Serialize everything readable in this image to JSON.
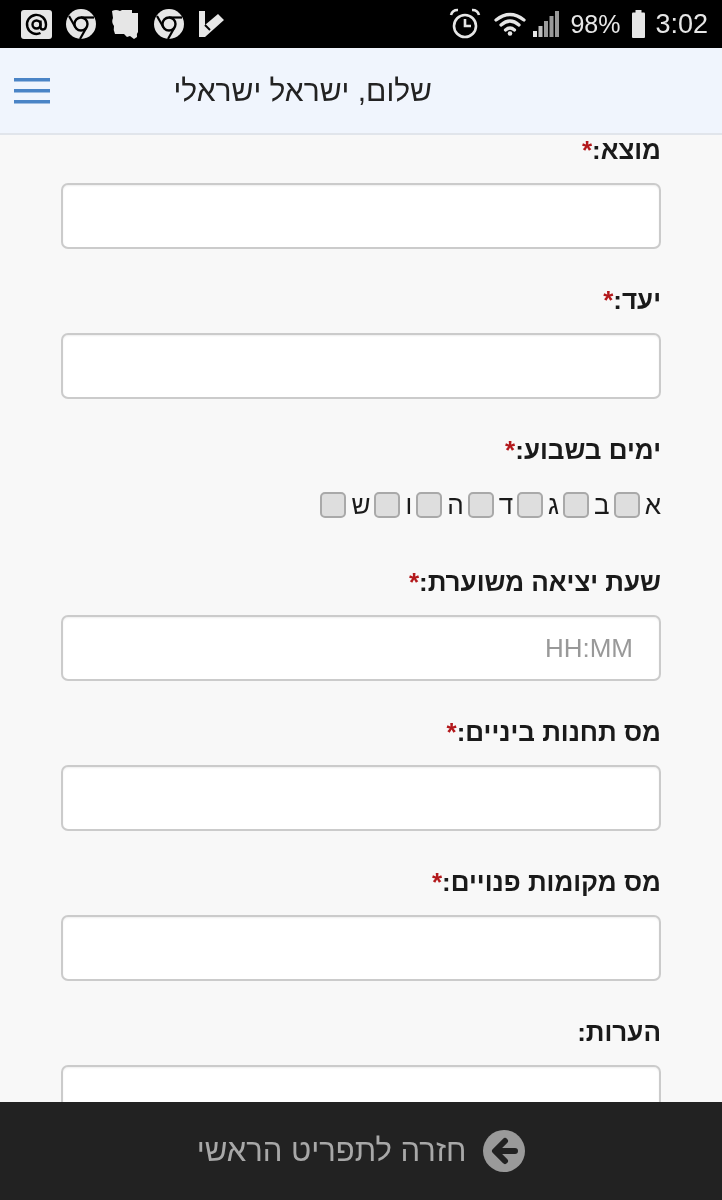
{
  "status_bar": {
    "battery": "98%",
    "time": "3:02"
  },
  "header": {
    "title": "שלום, ישראל ישראלי"
  },
  "form": {
    "fields": [
      {
        "kind": "text",
        "label": "מוצא:",
        "required_mark": "*"
      },
      {
        "kind": "text",
        "label": "יעד:",
        "required_mark": "*"
      },
      {
        "kind": "days",
        "label": "ימים בשבוע:",
        "required_mark": "*",
        "days": [
          {
            "label": "א",
            "checked": false
          },
          {
            "label": "ב",
            "checked": false
          },
          {
            "label": "ג",
            "checked": false
          },
          {
            "label": "ד",
            "checked": false
          },
          {
            "label": "ה",
            "checked": false
          },
          {
            "label": "ו",
            "checked": false
          },
          {
            "label": "ש",
            "checked": false
          }
        ]
      },
      {
        "kind": "text",
        "label": "שעת יציאה משוערת:",
        "required_mark": "*",
        "placeholder": "HH:MM"
      },
      {
        "kind": "text",
        "label": "מס תחנות ביניים:",
        "required_mark": "*"
      },
      {
        "kind": "text",
        "label": "מס מקומות פנויים:",
        "required_mark": "*"
      },
      {
        "kind": "text",
        "label": "הערות:"
      }
    ]
  },
  "footer": {
    "back_button": "חזרה לתפריט הראשי"
  }
}
